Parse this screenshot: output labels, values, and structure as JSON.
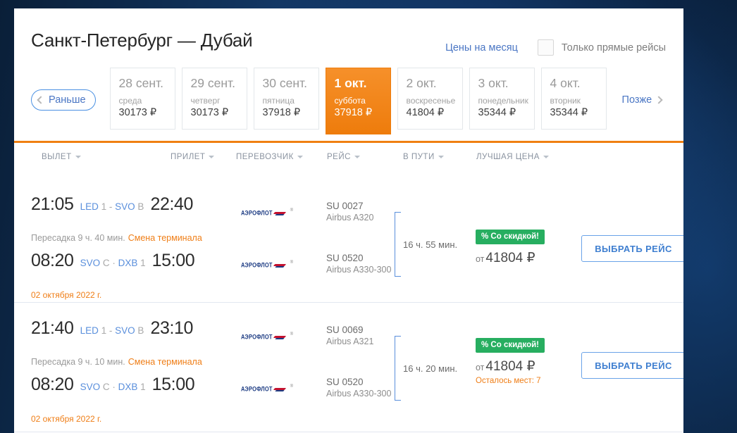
{
  "header": {
    "title": "Санкт-Петербург — Дубай",
    "month_prices_link": "Цены на месяц",
    "direct_only_label": "Только прямые рейсы",
    "direct_only_checked": false
  },
  "date_strip": {
    "earlier_label": "Раньше",
    "later_label": "Позже",
    "days": [
      {
        "date": "28 сент.",
        "dow": "среда",
        "price": "30173 ₽",
        "active": false
      },
      {
        "date": "29 сент.",
        "dow": "четверг",
        "price": "30173 ₽",
        "active": false
      },
      {
        "date": "30 сент.",
        "dow": "пятница",
        "price": "37918 ₽",
        "active": false
      },
      {
        "date": "1 окт.",
        "dow": "суббота",
        "price": "37918 ₽",
        "active": true
      },
      {
        "date": "2 окт.",
        "dow": "воскресенье",
        "price": "41804 ₽",
        "active": false
      },
      {
        "date": "3 окт.",
        "dow": "понедельник",
        "price": "35344 ₽",
        "active": false
      },
      {
        "date": "4 окт.",
        "dow": "вторник",
        "price": "35344 ₽",
        "active": false
      }
    ]
  },
  "columns": [
    {
      "label": "ВЫЛЕТ"
    },
    {
      "label": "ПРИЛЕТ"
    },
    {
      "label": "ПЕРЕВОЗЧИК"
    },
    {
      "label": "РЕЙС"
    },
    {
      "label": "В ПУТИ"
    },
    {
      "label": "ЛУЧШАЯ ЦЕНА"
    }
  ],
  "airline": {
    "name": "АЭРОФЛОТ",
    "mark": "®"
  },
  "flights": [
    {
      "leg1": {
        "depart_time": "21:05",
        "from_code": "LED",
        "from_term": "1",
        "to_code": "SVO",
        "to_term": "B",
        "arrive_time": "22:40",
        "flight_no": "SU 0027",
        "aircraft": "Airbus A320"
      },
      "transfer": "Пересадка 9 ч. 40 мин.",
      "terminal_change": "Смена терминала",
      "leg2": {
        "depart_time": "08:20",
        "from_code": "SVO",
        "from_term": "C",
        "to_code": "DXB",
        "to_term": "1",
        "arrive_time": "15:00",
        "flight_no": "SU 0520",
        "aircraft": "Airbus A330-300"
      },
      "arrive_date": "02 октября 2022 г.",
      "duration": "16 ч. 55 мин.",
      "badge": "% Со скидкой!",
      "price_prefix": "от",
      "price": "41804 ₽",
      "seats_left": "",
      "select_label": "ВЫБРАТЬ РЕЙС"
    },
    {
      "leg1": {
        "depart_time": "21:40",
        "from_code": "LED",
        "from_term": "1",
        "to_code": "SVO",
        "to_term": "B",
        "arrive_time": "23:10",
        "flight_no": "SU 0069",
        "aircraft": "Airbus A321"
      },
      "transfer": "Пересадка 9 ч. 10 мин.",
      "terminal_change": "Смена терминала",
      "leg2": {
        "depart_time": "08:20",
        "from_code": "SVO",
        "from_term": "C",
        "to_code": "DXB",
        "to_term": "1",
        "arrive_time": "15:00",
        "flight_no": "SU 0520",
        "aircraft": "Airbus A330-300"
      },
      "arrive_date": "02 октября 2022 г.",
      "duration": "16 ч. 20 мин.",
      "badge": "% Со скидкой!",
      "price_prefix": "от",
      "price": "41804 ₽",
      "seats_left": "Осталось мест: 7",
      "select_label": "ВЫБРАТЬ РЕЙС"
    }
  ],
  "colors": {
    "accent_orange": "#f08012",
    "link_blue": "#4a76c4",
    "badge_green": "#27ae60",
    "code_blue": "#5a8fdc"
  }
}
